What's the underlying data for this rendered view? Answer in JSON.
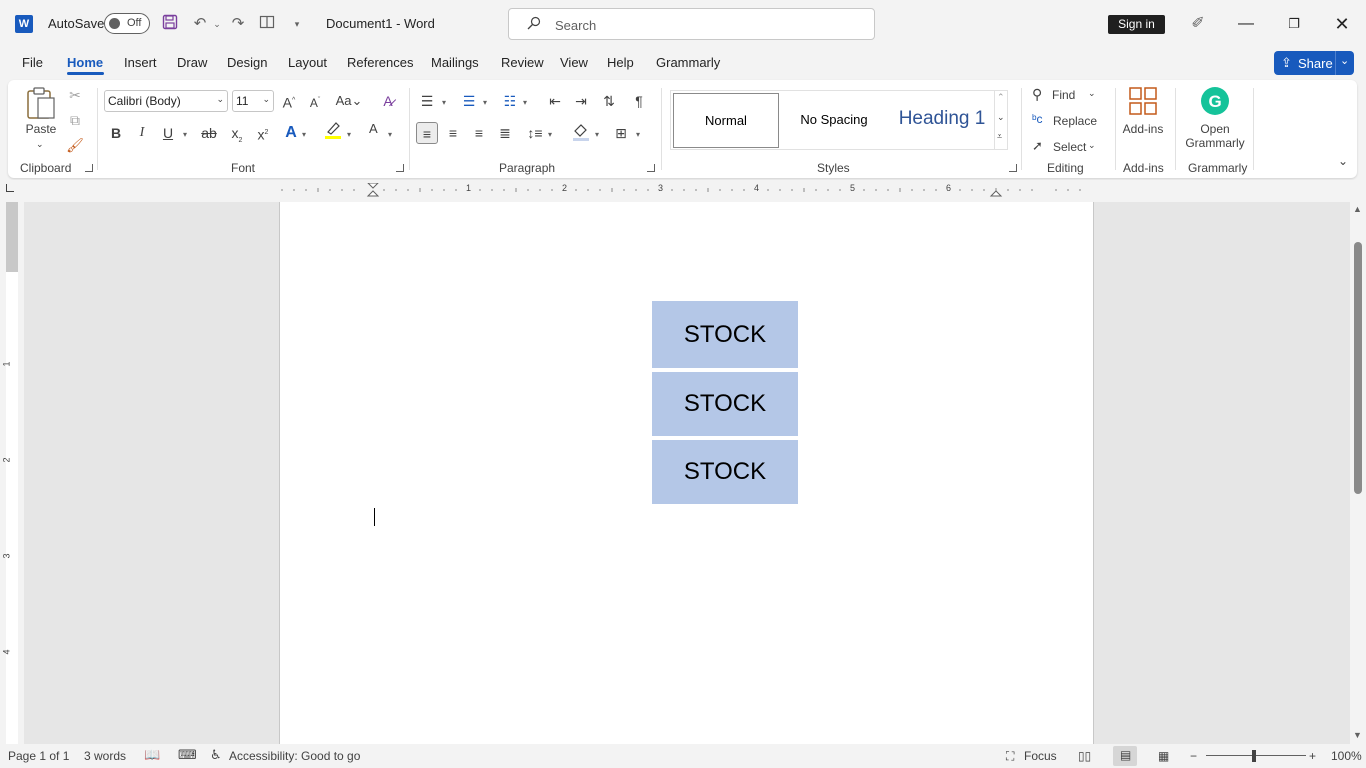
{
  "titlebar": {
    "autosave_label": "AutoSave",
    "autosave_state": "Off",
    "document_title": "Document1  -  Word",
    "search_placeholder": "Search",
    "signin_label": "Sign in"
  },
  "menu": {
    "tabs": [
      "File",
      "Home",
      "Insert",
      "Draw",
      "Design",
      "Layout",
      "References",
      "Mailings",
      "Review",
      "View",
      "Help",
      "Grammarly"
    ],
    "active_tab": "Home",
    "share_label": "Share"
  },
  "ribbon": {
    "clipboard": {
      "paste_label": "Paste",
      "group_label": "Clipboard"
    },
    "font": {
      "font_name": "Calibri (Body)",
      "font_size": "11",
      "group_label": "Font"
    },
    "paragraph": {
      "group_label": "Paragraph"
    },
    "styles": {
      "items": [
        "Normal",
        "No Spacing",
        "Heading 1"
      ],
      "group_label": "Styles"
    },
    "editing": {
      "find_label": "Find",
      "replace_label": "Replace",
      "select_label": "Select",
      "group_label": "Editing"
    },
    "addins": {
      "label": "Add-ins",
      "group_label": "Add-ins"
    },
    "grammarly": {
      "label_line1": "Open",
      "label_line2": "Grammarly",
      "group_label": "Grammarly"
    }
  },
  "ruler": {
    "numbers": [
      "1",
      "2",
      "3",
      "4",
      "5",
      "6"
    ]
  },
  "vruler": {
    "numbers": [
      "1",
      "2",
      "3",
      "4"
    ]
  },
  "document": {
    "boxes": [
      "STOCK",
      "STOCK",
      "STOCK"
    ]
  },
  "statusbar": {
    "page": "Page 1 of 1",
    "words": "3 words",
    "accessibility": "Accessibility: Good to go",
    "focus": "Focus",
    "zoom": "100%"
  },
  "colors": {
    "accent": "#185abd",
    "stock_box": "#b4c7e7",
    "grammarly": "#15c39a"
  }
}
